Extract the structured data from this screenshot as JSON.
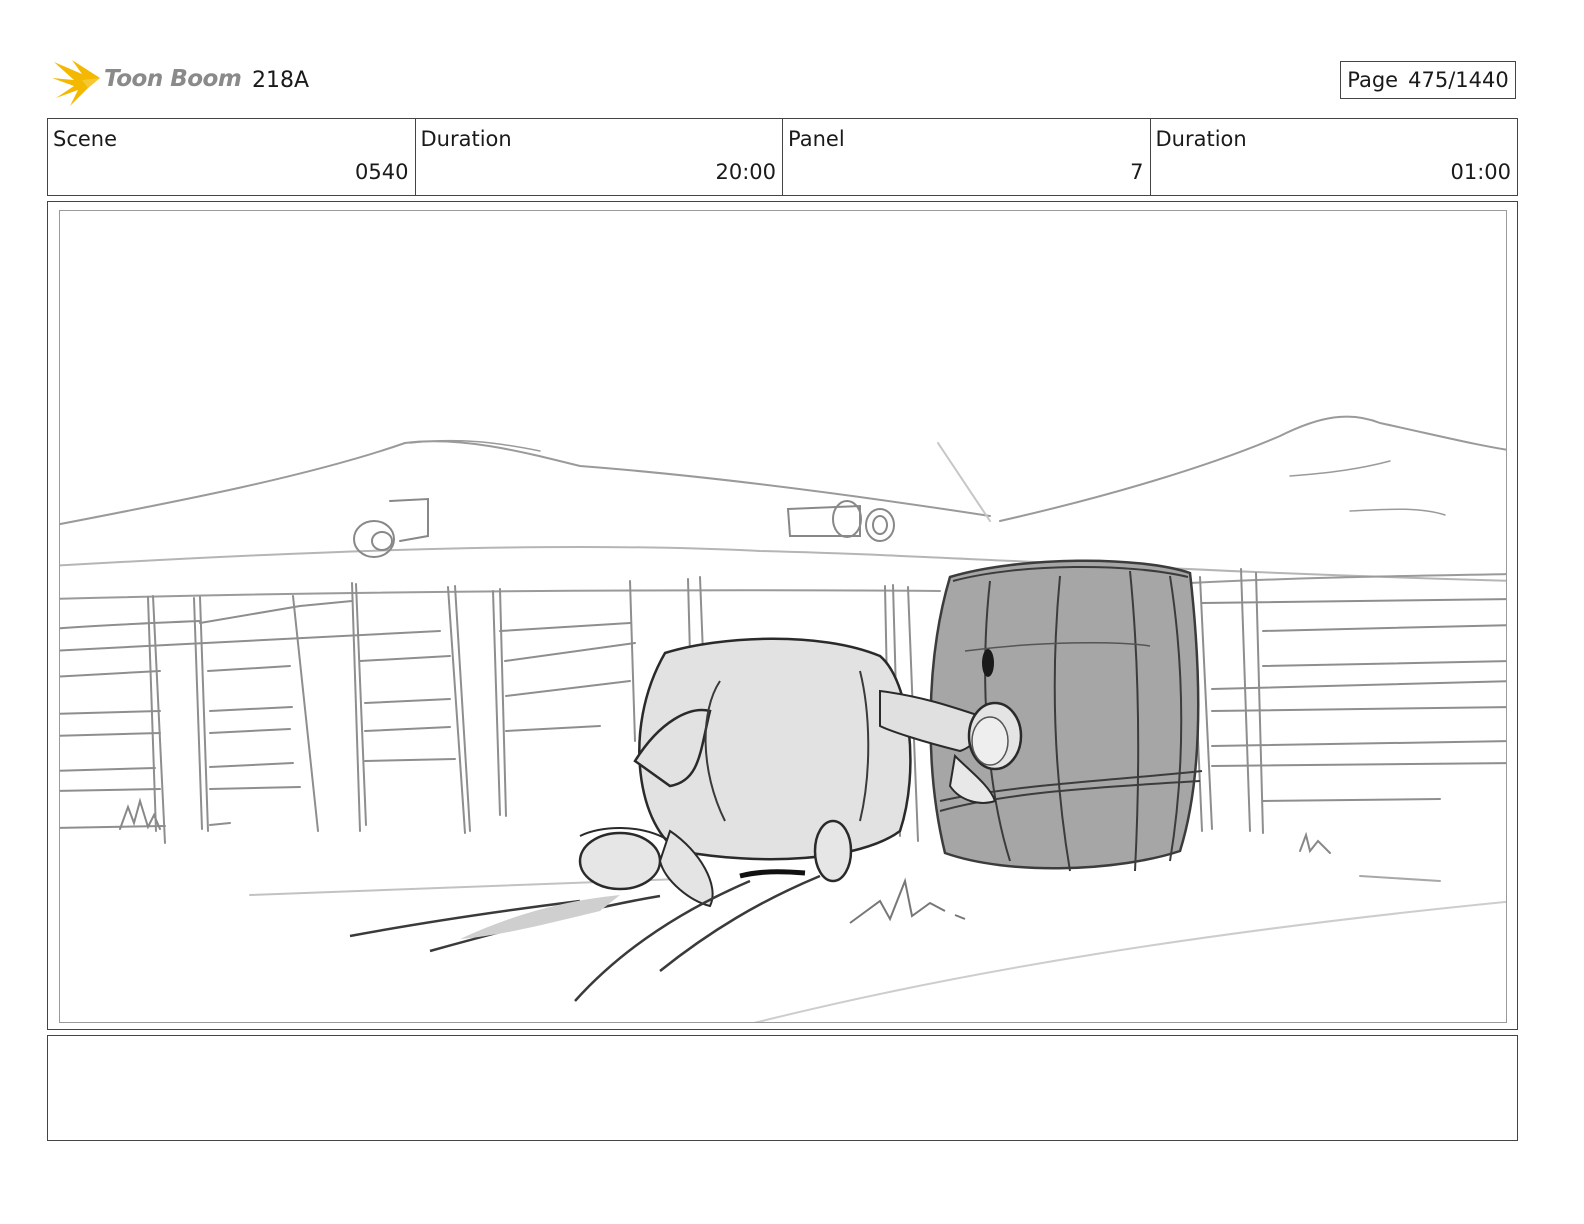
{
  "header": {
    "logo_text": "Toon Boom",
    "project_id": "218A",
    "page_label": "Page",
    "page_value": "475/1440"
  },
  "info": {
    "scene_label": "Scene",
    "scene_value": "0540",
    "scene_duration_label": "Duration",
    "scene_duration_value": "20:00",
    "panel_label": "Panel",
    "panel_value": "7",
    "panel_duration_label": "Duration",
    "panel_duration_value": "01:00"
  },
  "notes": {
    "text": ""
  },
  "colors": {
    "logo_flame": "#f5b800",
    "logo_text": "#8a8a8a",
    "sketch_line": "#8e8e8e",
    "barrel_fill": "#a9a9a9"
  }
}
